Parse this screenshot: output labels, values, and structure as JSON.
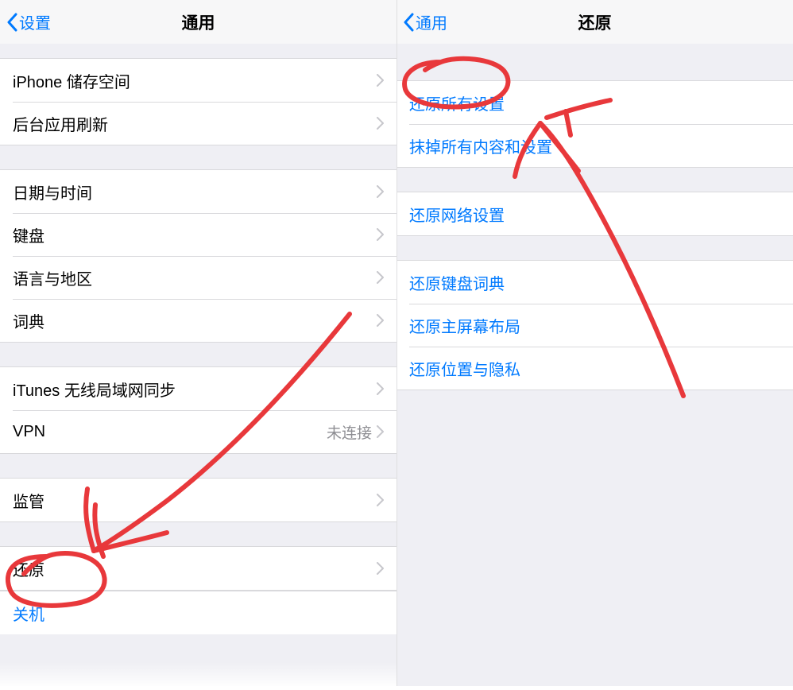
{
  "left": {
    "back_label": "设置",
    "title": "通用",
    "groups": [
      [
        {
          "label": "iPhone 储存空间",
          "chevron": true
        },
        {
          "label": "后台应用刷新",
          "chevron": true
        }
      ],
      [
        {
          "label": "日期与时间",
          "chevron": true
        },
        {
          "label": "键盘",
          "chevron": true
        },
        {
          "label": "语言与地区",
          "chevron": true
        },
        {
          "label": "词典",
          "chevron": true
        }
      ],
      [
        {
          "label": "iTunes 无线局域网同步",
          "chevron": true
        },
        {
          "label": "VPN",
          "detail": "未连接",
          "chevron": true
        }
      ],
      [
        {
          "label": "监管",
          "chevron": true
        }
      ],
      [
        {
          "label": "还原",
          "chevron": true
        }
      ]
    ],
    "footer_link": "关机"
  },
  "right": {
    "back_label": "通用",
    "title": "还原",
    "groups": [
      [
        {
          "label": "还原所有设置",
          "blue": true
        },
        {
          "label": "抹掉所有内容和设置",
          "blue": true
        }
      ],
      [
        {
          "label": "还原网络设置",
          "blue": true
        }
      ],
      [
        {
          "label": "还原键盘词典",
          "blue": true
        },
        {
          "label": "还原主屏幕布局",
          "blue": true
        },
        {
          "label": "还原位置与隐私",
          "blue": true
        }
      ]
    ]
  },
  "annotation_color": "#e8383b"
}
